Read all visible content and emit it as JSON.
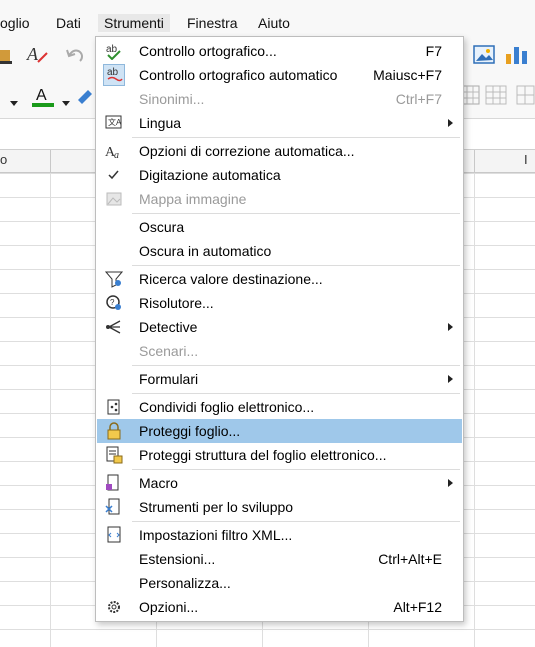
{
  "menubar": {
    "items": [
      "oglio",
      "Dati",
      "Strumenti",
      "Finestra",
      "Aiuto"
    ],
    "active_index": 2
  },
  "colors": {
    "highlight": "#9fc8ea",
    "font_color_bar": "#1a9a1a",
    "disabled_text": "#9a9a9a"
  },
  "menu": {
    "items": [
      {
        "label": "Controllo ortografico...",
        "shortcut": "F7",
        "icon": "spellcheck-icon"
      },
      {
        "label": "Controllo ortografico automatico",
        "shortcut": "Maiusc+F7",
        "icon": "auto-spellcheck-icon"
      },
      {
        "label": "Sinonimi...",
        "shortcut": "Ctrl+F7",
        "disabled": true
      },
      {
        "label": "Lingua",
        "submenu": true,
        "icon": "language-icon"
      },
      {
        "label": "Opzioni di correzione automatica...",
        "icon": "autocorrect-icon"
      },
      {
        "label": "Digitazione automatica",
        "icon": "checkmark-icon"
      },
      {
        "label": "Mappa immagine",
        "disabled": true,
        "icon": "image-map-icon"
      },
      {
        "label": "Oscura"
      },
      {
        "label": "Oscura in automatico"
      },
      {
        "label": "Ricerca valore destinazione...",
        "icon": "goal-seek-icon"
      },
      {
        "label": "Risolutore...",
        "icon": "solver-icon"
      },
      {
        "label": "Detective",
        "submenu": true,
        "icon": "detective-icon"
      },
      {
        "label": "Scenari...",
        "disabled": true
      },
      {
        "label": "Formulari",
        "submenu": true
      },
      {
        "label": "Condividi foglio elettronico...",
        "icon": "share-icon"
      },
      {
        "label": "Proteggi foglio...",
        "icon": "lock-icon",
        "highlighted": true
      },
      {
        "label": "Proteggi struttura del foglio elettronico...",
        "icon": "protect-structure-icon"
      },
      {
        "label": "Macro",
        "submenu": true,
        "icon": "macro-icon"
      },
      {
        "label": "Strumenti per lo sviluppo",
        "icon": "dev-tools-icon"
      },
      {
        "label": "Impostazioni filtro XML...",
        "icon": "xml-filter-icon"
      },
      {
        "label": "Estensioni...",
        "shortcut": "Ctrl+Alt+E"
      },
      {
        "label": "Personalizza..."
      },
      {
        "label": "Opzioni...",
        "shortcut": "Alt+F12",
        "icon": "gear-icon"
      }
    ]
  },
  "column_header": {
    "left_label": "o",
    "right_label": "I"
  }
}
